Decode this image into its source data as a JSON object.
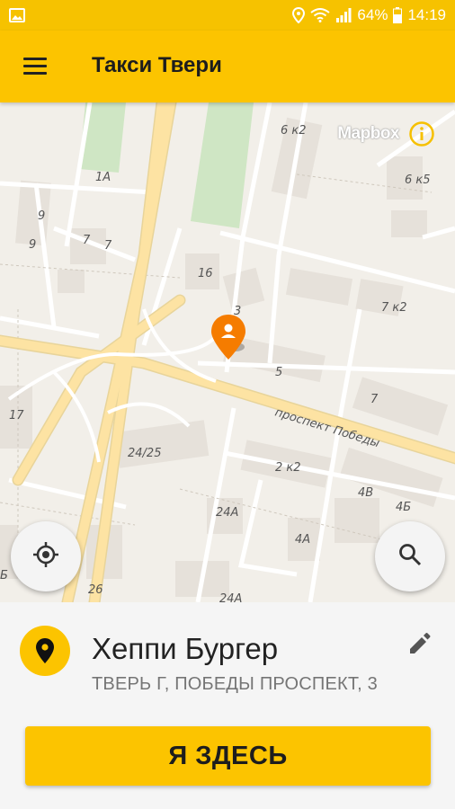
{
  "status_bar": {
    "battery": "64%",
    "time": "14:19",
    "icons": [
      "image-icon",
      "location-icon",
      "wifi-icon",
      "signal-icon",
      "battery-icon"
    ]
  },
  "app_bar": {
    "title": "Такси Твери",
    "menu_icon": "hamburger-menu-icon"
  },
  "map": {
    "attribution": "Mapbox",
    "street_label": "проспект Победы",
    "building_labels": [
      "6 к2",
      "1А",
      "9",
      "9",
      "7",
      "7",
      "16",
      "3",
      "7 к2",
      "6 к5",
      "5",
      "7",
      "17",
      "24/25",
      "2 к2",
      "4В",
      "4Б",
      "24А",
      "4А",
      "26",
      "Б",
      "24А"
    ],
    "marker_icon": "user-pin-icon",
    "locate_icon": "my-location-icon",
    "search_icon": "search-icon"
  },
  "place": {
    "name": "Хеппи Бургер",
    "address": "ТВЕРЬ Г, ПОБЕДЫ ПРОСПЕКТ, 3",
    "icon": "place-pin-icon",
    "edit_icon": "pencil-icon"
  },
  "actions": {
    "here_label": "Я ЗДЕСЬ"
  },
  "colors": {
    "accent": "#fcc400",
    "marker": "#f57c00",
    "road_major": "#fbe3a0",
    "park": "#cfe6c4"
  }
}
